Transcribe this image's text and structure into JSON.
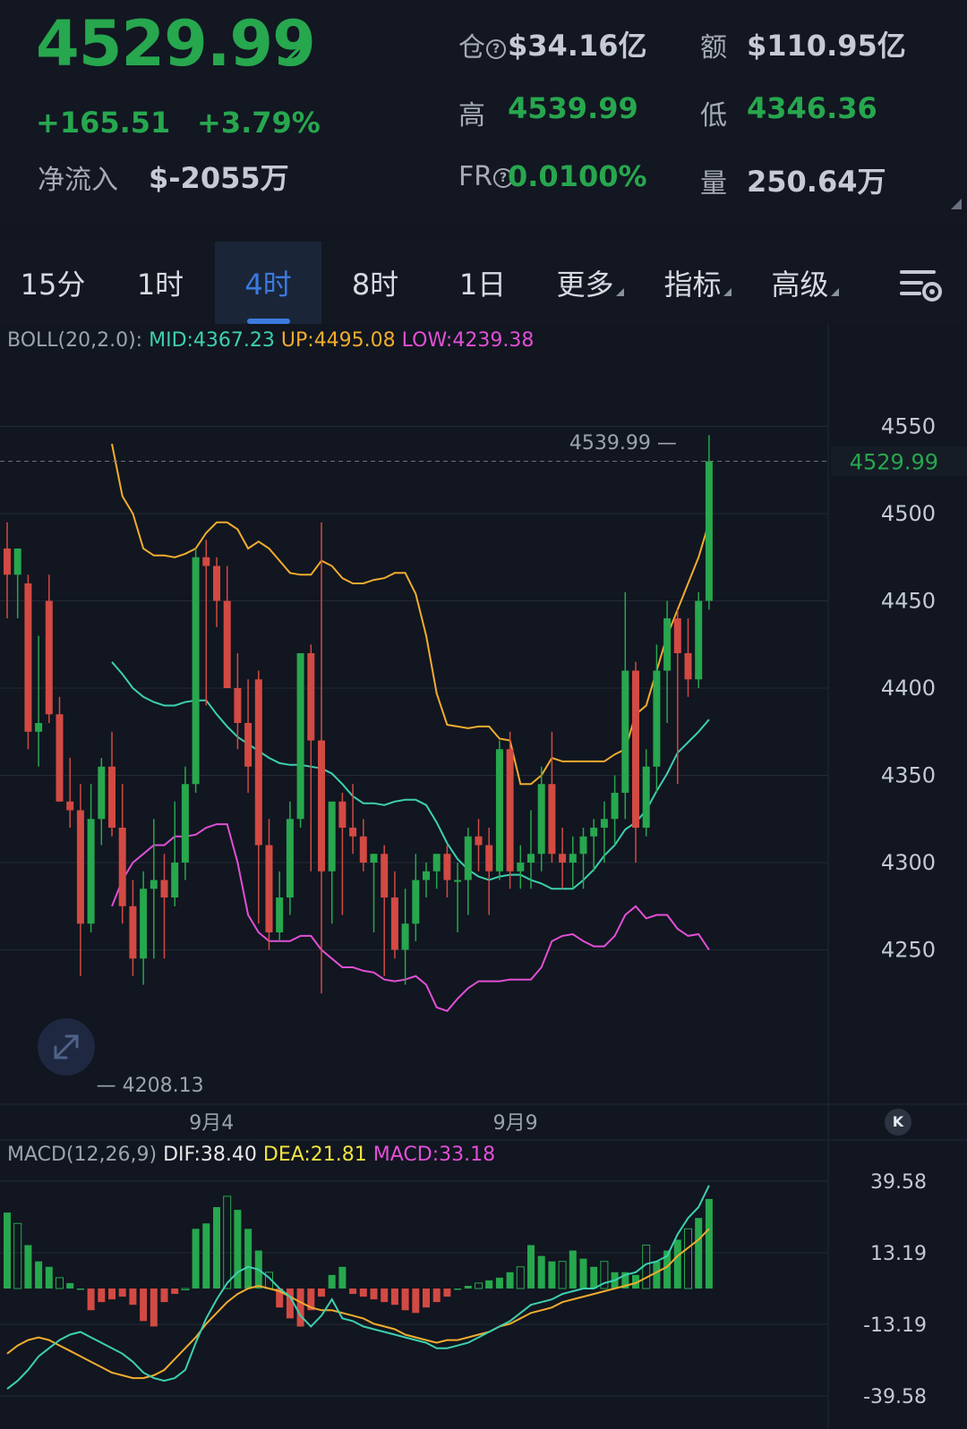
{
  "header": {
    "last_price": "4529.99",
    "change": "+165.51",
    "change_pct": "+3.79%",
    "net_inflow_label": "净流入",
    "net_inflow_value": "$-2055万",
    "open_interest_label": "仓",
    "open_interest_value": "$34.16亿",
    "turnover_label": "额",
    "turnover_value": "$110.95亿",
    "high_label": "高",
    "high_value": "4539.99",
    "low_label": "低",
    "low_value": "4346.36",
    "funding_label": "FR",
    "funding_value": "0.0100%",
    "volume_label": "量",
    "volume_value": "250.64万",
    "colors": {
      "up": "#27a74e",
      "down": "#d24a43"
    }
  },
  "tabs": [
    {
      "label": "15分",
      "active": false
    },
    {
      "label": "1时",
      "active": false
    },
    {
      "label": "4时",
      "active": true
    },
    {
      "label": "8时",
      "active": false
    },
    {
      "label": "1日",
      "active": false
    },
    {
      "label": "更多",
      "active": false
    },
    {
      "label": "指标",
      "active": false
    },
    {
      "label": "高级",
      "active": false
    }
  ],
  "settings_icon": "chart-settings-icon",
  "chart_data": [
    {
      "type": "candlestick",
      "indicator": {
        "name": "BOLL(20,2.0):",
        "mid_label": "MID:4367.23",
        "up_label": "UP:4495.08",
        "low_label": "LOW:4239.38"
      },
      "ylim": [
        4190,
        4590
      ],
      "y_ticks": [
        "4550",
        "4500",
        "4450",
        "4400",
        "4350",
        "4300",
        "4250"
      ],
      "x_ticks": [
        {
          "label": "9月4",
          "index": 19
        },
        {
          "label": "9月9",
          "index": 48
        }
      ],
      "last_price_label": "4529.99",
      "max_marker": "4539.99",
      "min_marker": "4208.13",
      "colors": {
        "up": "#27a74e",
        "down": "#d24a43",
        "mid": "#3dd0b0",
        "upper": "#f2ac2e",
        "lower": "#e24fd6"
      },
      "ohlc": [
        [
          4480,
          4495,
          4440,
          4465
        ],
        [
          4465,
          4480,
          4440,
          4480
        ],
        [
          4460,
          4465,
          4365,
          4375
        ],
        [
          4375,
          4430,
          4355,
          4380
        ],
        [
          4450,
          4465,
          4380,
          4385
        ],
        [
          4385,
          4395,
          4335,
          4335
        ],
        [
          4335,
          4360,
          4320,
          4330
        ],
        [
          4330,
          4345,
          4235,
          4265
        ],
        [
          4265,
          4345,
          4260,
          4325
        ],
        [
          4325,
          4360,
          4310,
          4355
        ],
        [
          4355,
          4375,
          4315,
          4320
        ],
        [
          4320,
          4345,
          4265,
          4275
        ],
        [
          4275,
          4290,
          4235,
          4245
        ],
        [
          4245,
          4295,
          4230,
          4285
        ],
        [
          4285,
          4325,
          4245,
          4290
        ],
        [
          4290,
          4305,
          4245,
          4280
        ],
        [
          4280,
          4335,
          4275,
          4300
        ],
        [
          4300,
          4355,
          4290,
          4345
        ],
        [
          4345,
          4480,
          4340,
          4475
        ],
        [
          4475,
          4485,
          4390,
          4470
        ],
        [
          4470,
          4475,
          4435,
          4450
        ],
        [
          4450,
          4470,
          4400,
          4400
        ],
        [
          4400,
          4420,
          4365,
          4380
        ],
        [
          4380,
          4405,
          4340,
          4355
        ],
        [
          4405,
          4410,
          4265,
          4310
        ],
        [
          4310,
          4325,
          4250,
          4260
        ],
        [
          4260,
          4295,
          4255,
          4280
        ],
        [
          4280,
          4335,
          4270,
          4325
        ],
        [
          4325,
          4420,
          4320,
          4420
        ],
        [
          4420,
          4425,
          4295,
          4370
        ],
        [
          4370,
          4495,
          4225,
          4295
        ],
        [
          4295,
          4325,
          4265,
          4335
        ],
        [
          4335,
          4340,
          4270,
          4320
        ],
        [
          4320,
          4345,
          4305,
          4315
        ],
        [
          4315,
          4325,
          4295,
          4300
        ],
        [
          4300,
          4305,
          4260,
          4305
        ],
        [
          4305,
          4310,
          4235,
          4280
        ],
        [
          4280,
          4295,
          4245,
          4250
        ],
        [
          4250,
          4285,
          4230,
          4265
        ],
        [
          4265,
          4305,
          4255,
          4290
        ],
        [
          4290,
          4300,
          4280,
          4295
        ],
        [
          4295,
          4305,
          4285,
          4305
        ],
        [
          4305,
          4310,
          4280,
          4290
        ],
        [
          4290,
          4300,
          4260,
          4290
        ],
        [
          4290,
          4320,
          4270,
          4315
        ],
        [
          4315,
          4325,
          4295,
          4310
        ],
        [
          4310,
          4320,
          4270,
          4295
        ],
        [
          4295,
          4370,
          4290,
          4365
        ],
        [
          4365,
          4375,
          4285,
          4295
        ],
        [
          4295,
          4310,
          4285,
          4300
        ],
        [
          4300,
          4330,
          4285,
          4305
        ],
        [
          4305,
          4355,
          4295,
          4345
        ],
        [
          4345,
          4375,
          4300,
          4305
        ],
        [
          4305,
          4320,
          4285,
          4300
        ],
        [
          4300,
          4315,
          4285,
          4305
        ],
        [
          4305,
          4320,
          4285,
          4315
        ],
        [
          4315,
          4325,
          4295,
          4320
        ],
        [
          4320,
          4335,
          4300,
          4325
        ],
        [
          4325,
          4350,
          4310,
          4340
        ],
        [
          4340,
          4455,
          4325,
          4410
        ],
        [
          4410,
          4415,
          4300,
          4320
        ],
        [
          4320,
          4365,
          4315,
          4355
        ],
        [
          4355,
          4425,
          4340,
          4410
        ],
        [
          4410,
          4450,
          4380,
          4440
        ],
        [
          4440,
          4445,
          4345,
          4420
        ],
        [
          4420,
          4440,
          4395,
          4405
        ],
        [
          4405,
          4455,
          4400,
          4450
        ],
        [
          4450,
          4545,
          4445,
          4530
        ]
      ],
      "boll_mid": [
        4415,
        4408,
        4400,
        4395,
        4392,
        4390,
        4390,
        4392,
        4393,
        4393,
        4385,
        4378,
        4372,
        4368,
        4364,
        4360,
        4357,
        4356,
        4356,
        4355,
        4354,
        4351,
        4345,
        4338,
        4334,
        4334,
        4333,
        4335,
        4336,
        4336,
        4333,
        4323,
        4311,
        4302,
        4296,
        4292,
        4290,
        4292,
        4293,
        4293,
        4290,
        4288,
        4285,
        4285,
        4285,
        4290,
        4296,
        4304,
        4310,
        4319,
        4323,
        4330,
        4341,
        4351,
        4363,
        4369,
        4375,
        4382
      ],
      "boll_upper": [
        4540,
        4510,
        4500,
        4480,
        4476,
        4476,
        4475,
        4477,
        4480,
        4489,
        4495,
        4495,
        4491,
        4480,
        4484,
        4480,
        4473,
        4466,
        4465,
        4465,
        4473,
        4470,
        4463,
        4460,
        4460,
        4462,
        4463,
        4466,
        4466,
        4454,
        4430,
        4397,
        4379,
        4378,
        4377,
        4378,
        4378,
        4371,
        4370,
        4345,
        4345,
        4350,
        4360,
        4358,
        4358,
        4358,
        4358,
        4358,
        4362,
        4365,
        4385,
        4390,
        4410,
        4430,
        4445,
        4460,
        4475,
        4495
      ],
      "boll_lower": [
        4275,
        4290,
        4300,
        4305,
        4310,
        4310,
        4315,
        4315,
        4316,
        4320,
        4322,
        4322,
        4300,
        4270,
        4260,
        4255,
        4255,
        4255,
        4258,
        4258,
        4250,
        4245,
        4240,
        4240,
        4238,
        4237,
        4233,
        4232,
        4233,
        4235,
        4230,
        4217,
        4215,
        4222,
        4228,
        4232,
        4232,
        4232,
        4233,
        4233,
        4233,
        4240,
        4255,
        4258,
        4259,
        4255,
        4252,
        4252,
        4258,
        4270,
        4275,
        4268,
        4270,
        4270,
        4262,
        4258,
        4259,
        4250
      ]
    },
    {
      "type": "bar-line",
      "indicator": {
        "name": "MACD(12,26,9)",
        "dif_label": "DIF:38.40",
        "dea_label": "DEA:21.81",
        "macd_label": "MACD:33.18"
      },
      "ylim": [
        -39.58,
        39.58
      ],
      "y_ticks": [
        "39.58",
        "13.19",
        "-13.19",
        "-39.58"
      ],
      "histogram": [
        28,
        24,
        16,
        10,
        8,
        4,
        2,
        0,
        -8,
        -5,
        -4,
        -3,
        -6,
        -12,
        -14,
        -5,
        -2,
        0,
        22,
        24,
        30,
        34,
        29,
        22,
        14,
        6,
        -7,
        -11,
        -14,
        -8,
        -3,
        5,
        8,
        -2,
        -3,
        -4,
        -5,
        -6,
        -8,
        -9,
        -7,
        -5,
        -3,
        0,
        1,
        2,
        3,
        4,
        6,
        8,
        16,
        12,
        10,
        10,
        14,
        11,
        8,
        10,
        6,
        6,
        5,
        16,
        10,
        14,
        18,
        22,
        26,
        33
      ],
      "dif": [
        -37,
        -34,
        -30,
        -25,
        -22,
        -19,
        -17,
        -16,
        -18,
        -20,
        -22,
        -24,
        -27,
        -31,
        -33,
        -34,
        -33,
        -30,
        -20,
        -11,
        -4,
        2,
        6,
        8,
        7,
        4,
        0,
        -3,
        -10,
        -14,
        -10,
        -4,
        -11,
        -12,
        -14,
        -15,
        -16,
        -17,
        -18,
        -19,
        -20,
        -22,
        -22,
        -21,
        -20,
        -18,
        -16,
        -14,
        -12,
        -9,
        -6,
        -5,
        -4,
        -2,
        -1,
        0,
        0,
        2,
        3,
        5,
        6,
        9,
        10,
        12,
        20,
        26,
        30,
        38
      ],
      "dea": [
        -24,
        -21,
        -19,
        -18,
        -19,
        -21,
        -23,
        -25,
        -27,
        -29,
        -31,
        -32,
        -33,
        -33,
        -32,
        -30,
        -26,
        -22,
        -18,
        -13,
        -9,
        -5,
        -2,
        0,
        1,
        0,
        -1,
        -3,
        -5,
        -7,
        -8,
        -8,
        -9,
        -10,
        -11,
        -13,
        -14,
        -15,
        -17,
        -18,
        -19,
        -20,
        -19,
        -19,
        -18,
        -17,
        -16,
        -14,
        -13,
        -11,
        -9,
        -8,
        -7,
        -5,
        -4,
        -3,
        -2,
        -1,
        0,
        1,
        2,
        4,
        6,
        8,
        12,
        15,
        18,
        22
      ]
    }
  ]
}
